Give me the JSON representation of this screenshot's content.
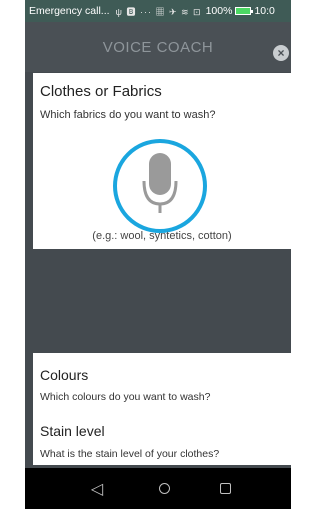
{
  "status_bar": {
    "carrier": "Emergency call...",
    "icons": "ψ 🅱 ··· ▦ ✈ ≋ ⊡",
    "battery_pct": "100%",
    "time": "10:0"
  },
  "header": {
    "title": "VOICE COACH",
    "close_label": "×"
  },
  "clothes_card": {
    "title": "Clothes or Fabrics",
    "question": "Which fabrics do you want to wash?",
    "example": "(e.g.: wool, syntetics, cotton)"
  },
  "colours": {
    "title": "Colours",
    "question": "Which colours do you want to wash?"
  },
  "stain": {
    "title": "Stain level",
    "question": "What is the stain level of your clothes?"
  },
  "nav": {
    "back": "◁"
  },
  "colors": {
    "accent": "#1aa6df",
    "mic": "#9a9a9a",
    "overlay": "#444a4f"
  }
}
